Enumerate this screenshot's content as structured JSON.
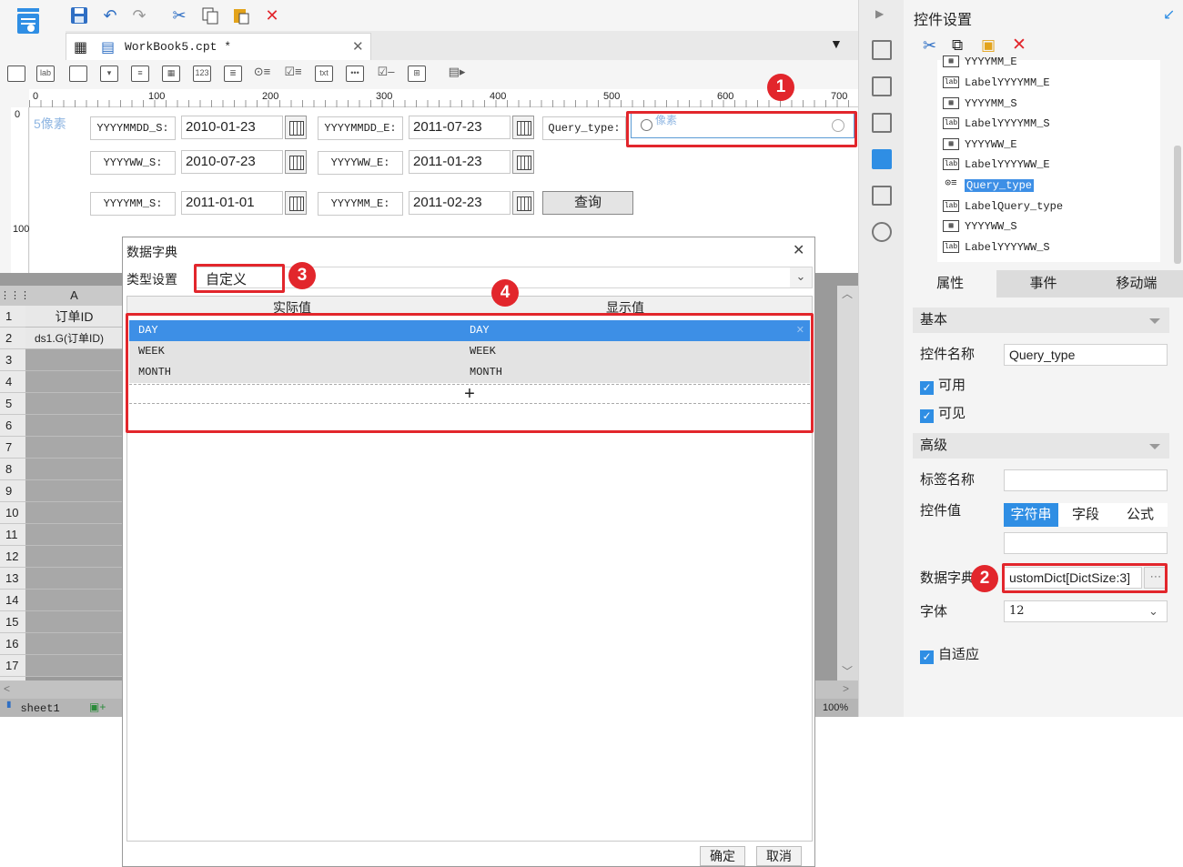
{
  "toolbar": {
    "icons": [
      "app-menu-icon",
      "save-icon",
      "undo-icon",
      "redo-icon",
      "cut-icon",
      "copy-icon",
      "paste-icon",
      "delete-icon"
    ]
  },
  "document_tab": {
    "title": "WorkBook5.cpt *"
  },
  "canvas": {
    "watermark_text": "5像素",
    "overlay_text": "像素",
    "rows": [
      {
        "label1": "YYYYMMDD_S:",
        "value1": "2010-01-23",
        "label2": "YYYYMMDD_E:",
        "value2": "2011-07-23",
        "label3": "Query_type:"
      },
      {
        "label1": "YYYYWW_S:",
        "value1": "2010-07-23",
        "label2": "YYYYWW_E:",
        "value2": "2011-01-23"
      },
      {
        "label1": "YYYYMM_S:",
        "value1": "2011-01-01",
        "label2": "YYYYMM_E:",
        "value2": "2011-02-23",
        "button": "查询"
      }
    ],
    "ruler_ticks": [
      "0",
      "100",
      "200",
      "300",
      "400",
      "500",
      "600",
      "700"
    ],
    "vruler_ticks": [
      "0",
      "100"
    ]
  },
  "sheet": {
    "column_header": "A",
    "rows": [
      "1",
      "2",
      "3",
      "4",
      "5",
      "6",
      "7",
      "8",
      "9",
      "10",
      "11",
      "12",
      "13",
      "14",
      "15",
      "16",
      "17"
    ],
    "cell_a1": "订单ID",
    "cell_a2": "ds1.G(订单ID)",
    "sheet_tab": "sheet1",
    "zoom": "100%"
  },
  "panel": {
    "title": "控件设置",
    "tree": [
      {
        "icon": "grid",
        "label": "YYYYMM_E"
      },
      {
        "icon": "lab",
        "label": "LabelYYYYMM_E"
      },
      {
        "icon": "grid",
        "label": "YYYYMM_S"
      },
      {
        "icon": "lab",
        "label": "LabelYYYYMM_S"
      },
      {
        "icon": "grid",
        "label": "YYYYWW_E"
      },
      {
        "icon": "lab",
        "label": "LabelYYYYWW_E"
      },
      {
        "icon": "radio",
        "label": "Query_type"
      },
      {
        "icon": "lab",
        "label": "LabelQuery_type"
      },
      {
        "icon": "grid",
        "label": "YYYYWW_S"
      },
      {
        "icon": "lab",
        "label": "LabelYYYYWW_S"
      }
    ],
    "tabs": [
      "属性",
      "事件",
      "移动端"
    ],
    "section_basic": "基本",
    "widget_name_label": "控件名称",
    "widget_name_value": "Query_type",
    "enabled_label": "可用",
    "visible_label": "可见",
    "section_advanced": "高级",
    "tag_name_label": "标签名称",
    "widget_value_label": "控件值",
    "value_tabs": [
      "字符串",
      "字段",
      "公式"
    ],
    "dict_label": "数据字典",
    "dict_value": "ustomDict[DictSize:3]",
    "font_label": "字体",
    "font_value": "12",
    "autofit_label": "自适应"
  },
  "dialog": {
    "title": "数据字典",
    "type_label": "类型设置",
    "type_value": "自定义",
    "col_actual": "实际值",
    "col_display": "显示值",
    "rows": [
      {
        "actual": "DAY",
        "display": "DAY"
      },
      {
        "actual": "WEEK",
        "display": "WEEK"
      },
      {
        "actual": "MONTH",
        "display": "MONTH"
      }
    ],
    "add_symbol": "+",
    "ok": "确定",
    "cancel": "取消"
  },
  "badges": [
    "1",
    "2",
    "3",
    "4"
  ],
  "colors": {
    "highlight": "#e2262c",
    "selection": "#3d8fe6",
    "accent": "#2f8ee4"
  }
}
